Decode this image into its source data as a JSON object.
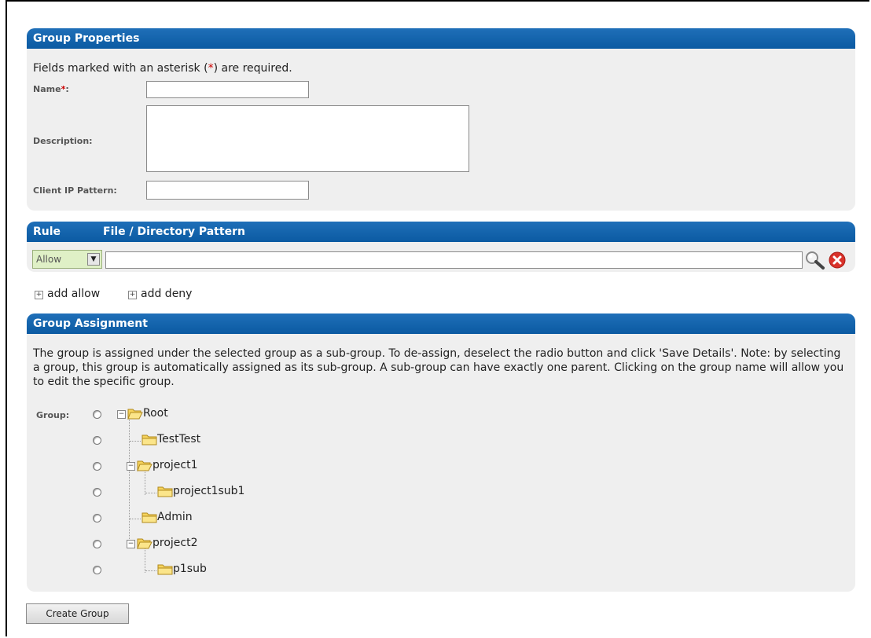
{
  "group_properties": {
    "header": "Group Properties",
    "required_note_before": "Fields marked with an asterisk (",
    "required_star": "*",
    "required_note_after": ") are required.",
    "name_label": "Name",
    "name_star": "*",
    "name_colon": ":",
    "name_value": "",
    "description_label": "Description:",
    "description_value": "",
    "client_ip_label": "Client IP Pattern:",
    "client_ip_value": ""
  },
  "rule": {
    "col_rule": "Rule",
    "col_pattern": "File / Directory Pattern",
    "selected_rule": "Allow",
    "pattern_value": "",
    "add_allow": "add allow",
    "add_deny": "add deny"
  },
  "group_assignment": {
    "header": "Group Assignment",
    "description": "The group is assigned under the selected group as a sub-group. To de-assign, deselect the radio button and click 'Save Details'. Note: by selecting a group, this group is automatically assigned as its sub-group. A sub-group can have exactly one parent. Clicking on the group name will allow you to edit the specific group.",
    "group_label": "Group:",
    "tree": [
      {
        "label": "Root",
        "expanded": true
      },
      {
        "label": "TestTest"
      },
      {
        "label": "project1",
        "expanded": true
      },
      {
        "label": "project1sub1"
      },
      {
        "label": "Admin"
      },
      {
        "label": "project2",
        "expanded": true
      },
      {
        "label": "p1sub"
      }
    ]
  },
  "actions": {
    "create_group": "Create Group"
  },
  "colors": {
    "header_blue": "#0b5aa2",
    "panel_bg": "#efefef",
    "required_red": "#cc0000",
    "select_green": "#dff0c6",
    "folder_yellow": "#f6d35c"
  },
  "icons": {
    "search": "magnifier-icon",
    "remove": "remove-circle-icon",
    "folder": "folder-icon",
    "expand": "minus-box-icon"
  }
}
